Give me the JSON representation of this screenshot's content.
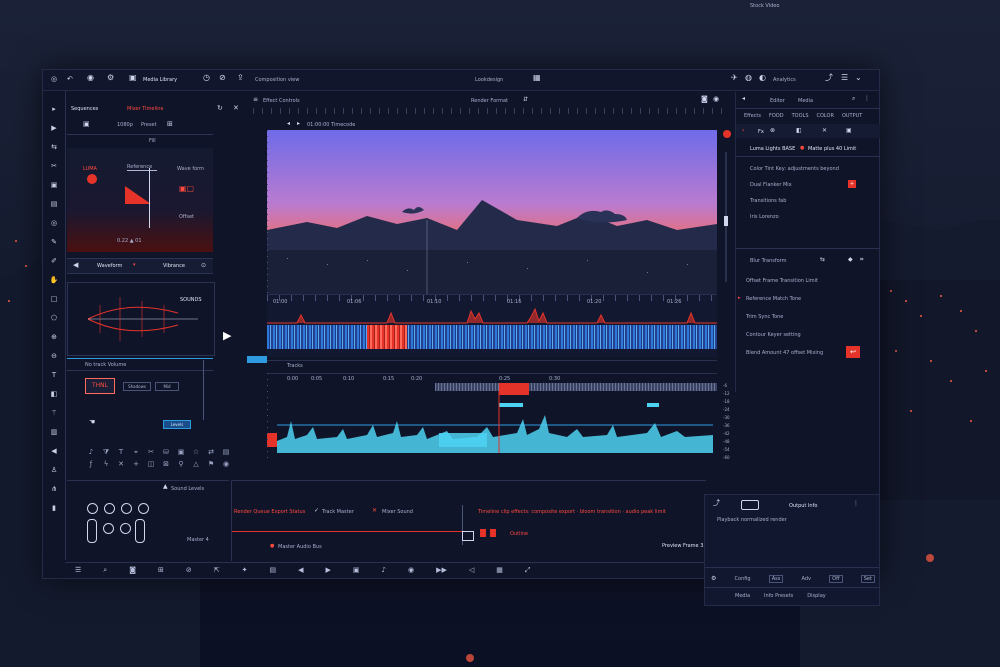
{
  "colors": {
    "accent": "#e5332a",
    "blue": "#2e9be0",
    "cyan": "#4ed2f2"
  },
  "outside": {
    "top_right_label": "Stock Video"
  },
  "topbar": {
    "left_title": "Media Library",
    "center_left": "Composition view",
    "center": "Lookdesign",
    "right_label": "Analytics"
  },
  "left_panel": {
    "header_label": "Sequences",
    "header_red": "Mixer Timeline",
    "tab_a": "1080p",
    "tab_b": "Preset",
    "scope_label": "LUMA",
    "scope_text1": "Reference",
    "scope_text2": "Wave form",
    "side_val": "Offset",
    "footer_vals": "0.22 ▲ 01",
    "nav_label": "Waveform",
    "nav_right": "Vibrance",
    "graph_label": "SOUNDS",
    "sub_label": "No track Volume",
    "badge": "THNL",
    "btn_a": "Shadows",
    "btn_b": "Mid",
    "blue_btn": "Levels"
  },
  "viewer": {
    "header_label": "Effect Controls",
    "header_mid": "Render Format",
    "sub_label": "01:00:00 Timecode",
    "timeline_labels": [
      "01:00",
      "01:06",
      "01:10",
      "01:16",
      "01:20",
      "01:26"
    ]
  },
  "audio": {
    "header_left": "Tracks",
    "ruler": [
      "0:00",
      "0:05",
      "0:10",
      "0:15",
      "0:20",
      "0:25",
      "0:30"
    ],
    "right_scale": [
      "-6",
      "-12",
      "-18",
      "-24",
      "-30",
      "-36",
      "-42",
      "-48",
      "-54",
      "-60"
    ]
  },
  "right_panel": {
    "tabs": [
      "Editor",
      "Media"
    ],
    "sub_tabs": [
      "Effects",
      "FOOD",
      "TOOLS",
      "COLOR",
      "OUTPUT"
    ],
    "items": [
      {
        "label": "Luma Lights BASE",
        "red": "Matte plus 40 Limit"
      },
      {
        "label": "Color Tint Key: adjustments beyond"
      },
      {
        "label": "Dual Flanker Mix"
      },
      {
        "label": "Transitions fab"
      },
      {
        "label": "Iris Lorenzo"
      },
      {
        "label": "Blur Transform"
      },
      {
        "label": "Offset Frame Transition Limit"
      },
      {
        "label": "Reference Match Tone"
      },
      {
        "label": "Trim Sync Tone"
      },
      {
        "label": "Contour Keyer setting"
      },
      {
        "label": "Blend Amount 47 offset Mixing"
      }
    ]
  },
  "bottom_left": {
    "label": "Sound Levels",
    "sub": "Master 4"
  },
  "bottom_mid": {
    "red_label": "Render Queue Export Status",
    "mid_label": "Track Master",
    "right_red": "Mixer Sound",
    "red_long": "Timeline clip effects: composite export · bloom transition · audio peak limit",
    "small_red": "Outline",
    "bottom_note": "Master Audio Bus",
    "right_note": "Preview Frame 3.0"
  },
  "bottom_right": {
    "title": "Output Info",
    "sub": "Playback normalized render",
    "btns": [
      "Config",
      "Ass",
      "Adv",
      "Off",
      "Set"
    ],
    "footer": [
      "Media",
      "Info Presets",
      "Display"
    ]
  }
}
